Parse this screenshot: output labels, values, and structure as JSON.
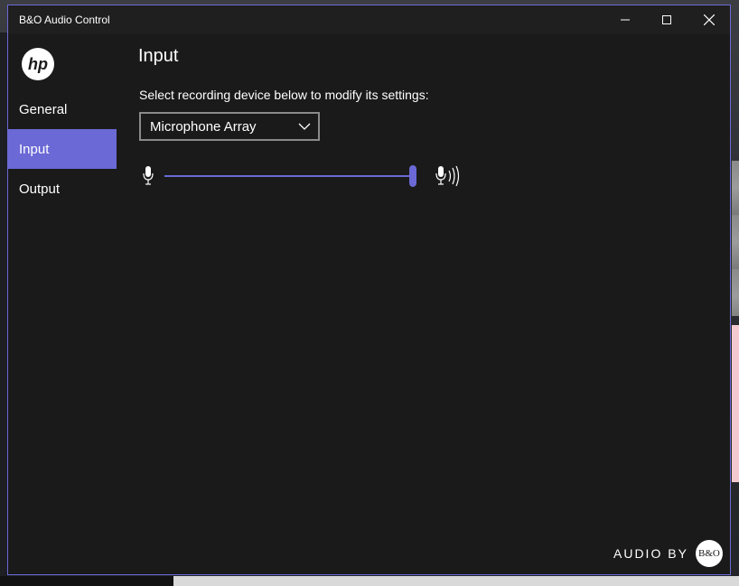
{
  "window": {
    "title": "B&O Audio Control",
    "accent_color": "#6b69d6",
    "controls": {
      "minimize_icon": "minimize-icon",
      "maximize_icon": "maximize-icon",
      "close_icon": "close-icon"
    }
  },
  "sidebar": {
    "logo_icon": "hp-logo",
    "logo_text": "hp",
    "items": [
      {
        "label": "General",
        "active": false
      },
      {
        "label": "Input",
        "active": true
      },
      {
        "label": "Output",
        "active": false
      }
    ]
  },
  "main": {
    "title": "Input",
    "device_label": "Select recording device below to modify its settings:",
    "device_select": {
      "selected": "Microphone Array"
    },
    "volume_slider": {
      "value_fraction": 1.0,
      "low_icon": "microphone-icon",
      "high_icon": "microphone-loud-icon"
    }
  },
  "footer": {
    "brand_text": "AUDIO BY",
    "badge_text": "B&O"
  }
}
